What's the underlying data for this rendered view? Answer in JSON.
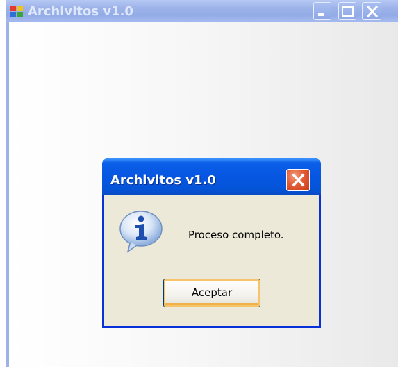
{
  "main_window": {
    "title": "Archivitos v1.0",
    "app_icon": "application-icon",
    "controls": [
      "minimize-icon",
      "maximize-icon",
      "close-icon"
    ]
  },
  "message_box": {
    "title": "Archivitos v1.0",
    "icon": "information-icon",
    "message": "Proceso completo.",
    "ok_label": "Aceptar",
    "close_icon": "close-icon"
  },
  "colors": {
    "active_titlebar": "#0756e2",
    "inactive_titlebar": "#9eb4ea",
    "dialog_face": "#ece9d8",
    "close_button": "#e25c35",
    "default_button_focus": "#f6c36b"
  }
}
